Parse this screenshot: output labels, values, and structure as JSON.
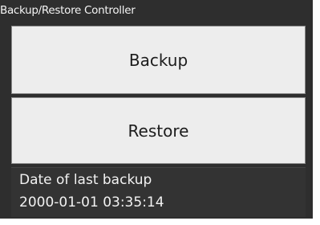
{
  "window": {
    "title": "Backup/Restore Controller"
  },
  "buttons": {
    "backup_label": "Backup",
    "restore_label": "Restore"
  },
  "last_backup": {
    "label": "Date of last backup",
    "value": "2000-01-01 03:35:14"
  },
  "colors": {
    "panel_background": "#2e2e2e",
    "button_background": "#ededed",
    "text_light": "#f2f2f2",
    "text_dark": "#1c1c1c"
  }
}
